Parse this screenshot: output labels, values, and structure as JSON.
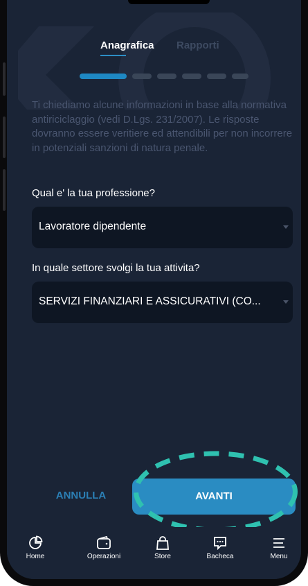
{
  "tabs": [
    {
      "label": "Anagrafica",
      "active": true
    },
    {
      "label": "Rapporti",
      "active": false
    }
  ],
  "progress": {
    "total_steps": 6,
    "current_step": 1
  },
  "intro_text": "Ti chiediamo alcune informazioni in base alla normativa antiriciclaggio (vedi D.Lgs. 231/2007). Le risposte dovranno essere veritiere ed attendibili per non incorrere in potenziali sanzioni di natura penale.",
  "questions": [
    {
      "label": "Qual e' la tua professione?",
      "value": "Lavoratore dipendente"
    },
    {
      "label": "In quale settore svolgi la tua attivita?",
      "value": "SERVIZI FINANZIARI E ASSICURATIVI (CO..."
    }
  ],
  "actions": {
    "cancel_label": "ANNULLA",
    "next_label": "AVANTI"
  },
  "nav": [
    {
      "label": "Home",
      "icon": "pie-chart-icon"
    },
    {
      "label": "Operazioni",
      "icon": "wallet-icon"
    },
    {
      "label": "Store",
      "icon": "shopping-bag-icon"
    },
    {
      "label": "Bacheca",
      "icon": "chat-bubble-icon"
    },
    {
      "label": "Menu",
      "icon": "menu-icon"
    }
  ],
  "colors": {
    "background": "#1a2436",
    "accent": "#2a8cc2",
    "highlight_dash": "#2fc1b0",
    "field_bg": "#0e1623"
  }
}
